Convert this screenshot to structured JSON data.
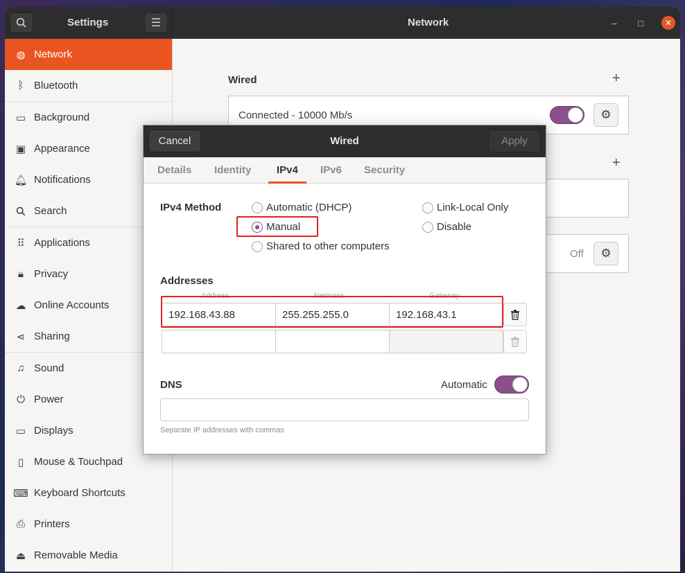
{
  "window": {
    "sidebar_title": "Settings",
    "main_title": "Network",
    "controls": {
      "minimize": "–",
      "maximize": "□",
      "close": "✕"
    }
  },
  "sidebar": {
    "items": [
      {
        "label": "Network",
        "icon": "network-icon",
        "active": true
      },
      {
        "label": "Bluetooth",
        "icon": "bluetooth-icon"
      },
      {
        "label": "Background",
        "icon": "background-icon"
      },
      {
        "label": "Appearance",
        "icon": "appearance-icon"
      },
      {
        "label": "Notifications",
        "icon": "bell-icon"
      },
      {
        "label": "Search",
        "icon": "search-icon"
      },
      {
        "label": "Applications",
        "icon": "apps-grid-icon"
      },
      {
        "label": "Privacy",
        "icon": "lock-icon"
      },
      {
        "label": "Online Accounts",
        "icon": "cloud-icon"
      },
      {
        "label": "Sharing",
        "icon": "share-icon"
      },
      {
        "label": "Sound",
        "icon": "music-note-icon"
      },
      {
        "label": "Power",
        "icon": "power-icon"
      },
      {
        "label": "Displays",
        "icon": "display-icon"
      },
      {
        "label": "Mouse & Touchpad",
        "icon": "mouse-icon"
      },
      {
        "label": "Keyboard Shortcuts",
        "icon": "keyboard-icon"
      },
      {
        "label": "Printers",
        "icon": "printer-icon"
      },
      {
        "label": "Removable Media",
        "icon": "removable-media-icon"
      }
    ]
  },
  "main": {
    "wired_title": "Wired",
    "wired_status": "Connected - 10000 Mb/s",
    "wired_enabled": true,
    "proxy_status": "Off"
  },
  "dialog": {
    "title": "Wired",
    "cancel_label": "Cancel",
    "apply_label": "Apply",
    "tabs": [
      "Details",
      "Identity",
      "IPv4",
      "IPv6",
      "Security"
    ],
    "active_tab": "IPv4",
    "ipv4_method_label": "IPv4 Method",
    "methods": {
      "automatic": "Automatic (DHCP)",
      "link_local": "Link-Local Only",
      "manual": "Manual",
      "disable": "Disable",
      "shared": "Shared to other computers"
    },
    "selected_method": "Manual",
    "addresses_label": "Addresses",
    "columns": {
      "address": "Address",
      "netmask": "Netmask",
      "gateway": "Gateway"
    },
    "rows": [
      {
        "address": "192.168.43.88",
        "netmask": "255.255.255.0",
        "gateway": "192.168.43.1"
      },
      {
        "address": "",
        "netmask": "",
        "gateway": ""
      }
    ],
    "dns_label": "DNS",
    "dns_automatic_label": "Automatic",
    "dns_automatic": true,
    "dns_value": "",
    "dns_hint": "Separate IP addresses with commas"
  },
  "colors": {
    "accent": "#e95420",
    "toggle": "#8a4f8c",
    "highlight_box": "#e02020"
  }
}
